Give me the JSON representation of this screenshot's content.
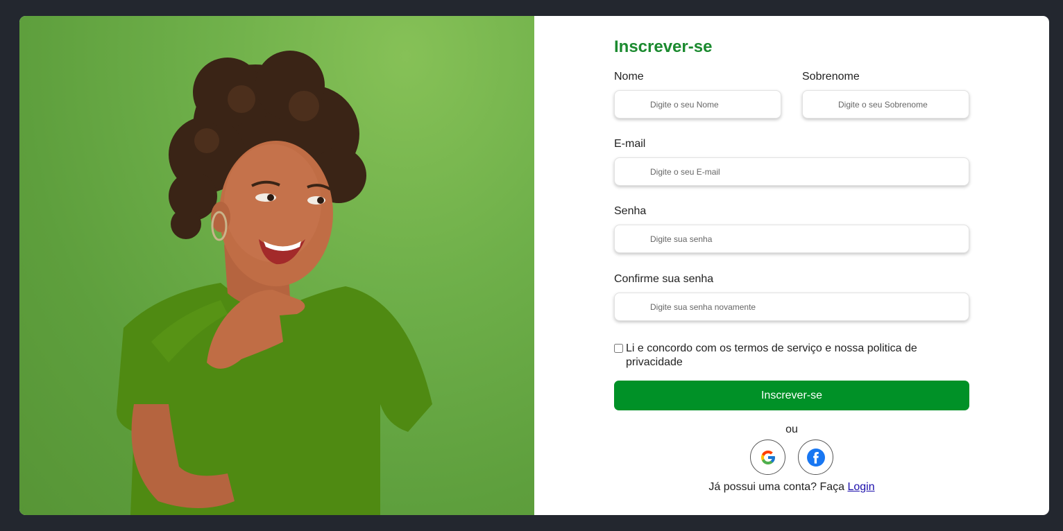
{
  "form": {
    "title": "Inscrever-se",
    "first_name": {
      "label": "Nome",
      "placeholder": "Digite o seu Nome",
      "value": ""
    },
    "last_name": {
      "label": "Sobrenome",
      "placeholder": "Digite o seu Sobrenome",
      "value": ""
    },
    "email": {
      "label": "E-mail",
      "placeholder": "Digite o seu E-mail",
      "value": ""
    },
    "password": {
      "label": "Senha",
      "placeholder": "Digite sua senha",
      "value": ""
    },
    "confirm_password": {
      "label": "Confirme sua senha",
      "placeholder": "Digite sua senha novamente",
      "value": ""
    },
    "terms_label": "Li e concordo com os termos de serviço e nossa politica de privacidade",
    "terms_checked": false,
    "submit_label": "Inscrever-se",
    "or_label": "ou",
    "social": [
      {
        "name": "google",
        "icon": "google-icon"
      },
      {
        "name": "facebook",
        "icon": "facebook-icon"
      }
    ],
    "login_prompt": "Já possui uma conta? Faça",
    "login_link": "Login"
  },
  "image": {
    "subject": "smiling woman with curly hair in green t-shirt",
    "background_color": "#6fb04a"
  },
  "colors": {
    "page_background": "#23272f",
    "accent_green": "#009127",
    "title_green": "#1b8a2f",
    "link_blue": "#1a0dab"
  }
}
